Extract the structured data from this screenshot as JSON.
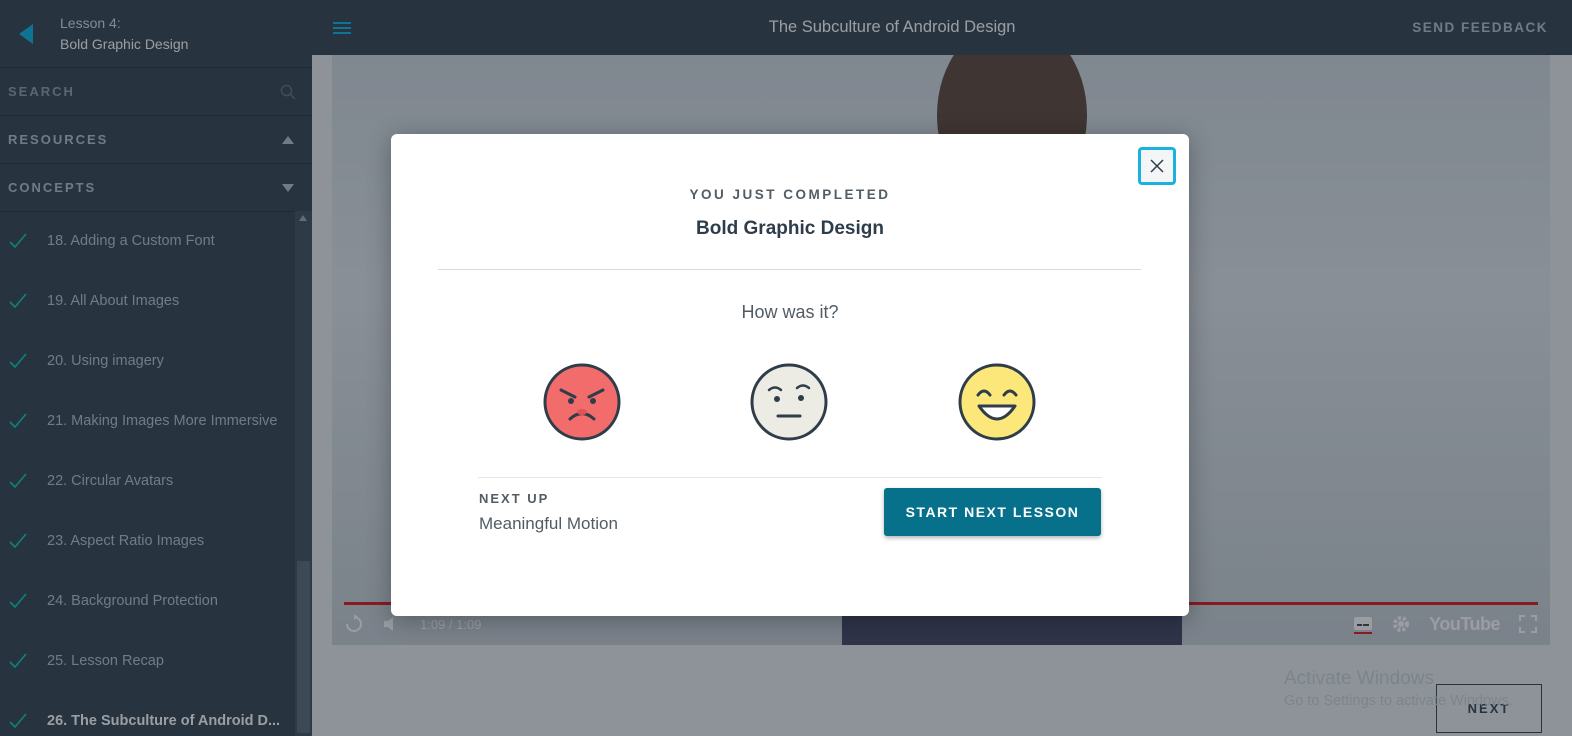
{
  "sidebar": {
    "lesson_number": "Lesson 4:",
    "lesson_title": "Bold Graphic Design",
    "search_label": "SEARCH",
    "resources_label": "RESOURCES",
    "concepts_label": "CONCEPTS",
    "concepts": [
      {
        "label": "18. Adding a Custom Font"
      },
      {
        "label": "19. All About Images"
      },
      {
        "label": "20. Using imagery"
      },
      {
        "label": "21. Making Images More Immersive"
      },
      {
        "label": "22. Circular Avatars"
      },
      {
        "label": "23. Aspect Ratio Images"
      },
      {
        "label": "24. Background Protection"
      },
      {
        "label": "25. Lesson Recap"
      },
      {
        "label": "26. The Subculture of Android D..."
      }
    ]
  },
  "header": {
    "title": "The Subculture of Android Design",
    "feedback_label": "SEND FEEDBACK"
  },
  "video": {
    "time": "1:09 / 1:09",
    "brand": "YouTube",
    "progress": 1.0
  },
  "watermark": {
    "line1": "Activate Windows",
    "line2": "Go to Settings to activate Windows."
  },
  "footer": {
    "next_label": "NEXT"
  },
  "modal": {
    "completed_label": "YOU JUST COMPLETED",
    "completed_title": "Bold Graphic Design",
    "question": "How was it?",
    "ratings": [
      "angry-face-icon",
      "neutral-face-icon",
      "happy-face-icon"
    ],
    "next_up_label": "NEXT UP",
    "next_up_title": "Meaningful Motion",
    "start_label": "START NEXT LESSON"
  },
  "colors": {
    "accent": "#02b3e4",
    "sidebar_bg": "#2e3d49",
    "check": "#02ccba",
    "primary_button": "#07718c",
    "angry": "#f26c6c",
    "neutral": "#ecebe4",
    "happy": "#fbe77a"
  }
}
